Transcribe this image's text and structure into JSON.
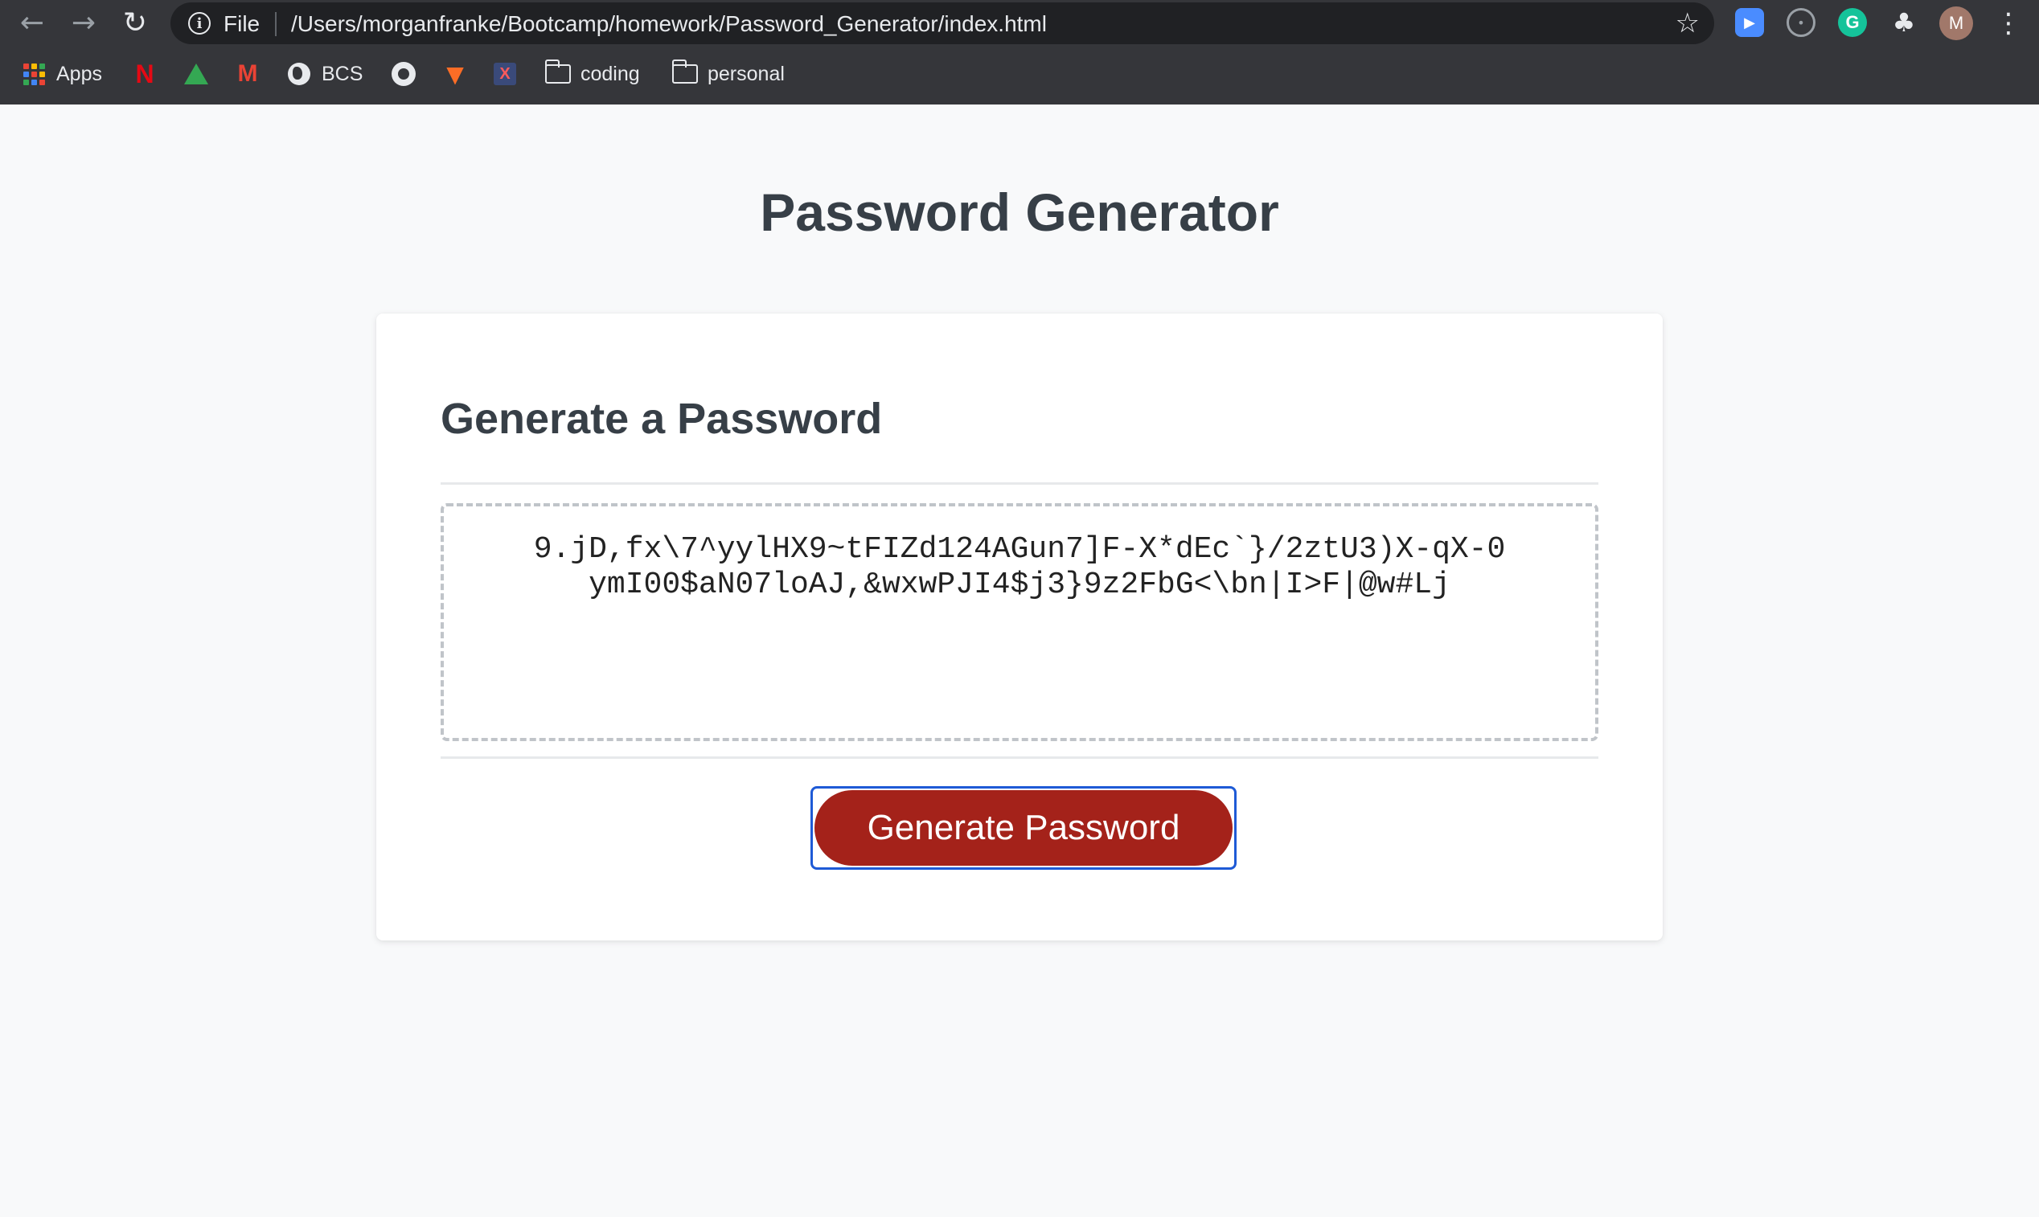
{
  "browser": {
    "nav": {
      "back_icon": "arrow-left-icon",
      "forward_icon": "arrow-right-icon",
      "reload_icon": "reload-icon"
    },
    "address_bar": {
      "scheme_label": "File",
      "url": "/Users/morganfranke/Bootcamp/homework/Password_Generator/index.html"
    },
    "extensions": [
      "zoom-extension-icon",
      "ghost-extension-icon",
      "grammarly-extension-icon",
      "puzzle-extensions-icon"
    ],
    "profile_initial": "M",
    "bookmarks": [
      {
        "label": "Apps",
        "icon": "apps-grid-icon"
      },
      {
        "label": "",
        "icon": "netflix-icon"
      },
      {
        "label": "",
        "icon": "google-drive-icon"
      },
      {
        "label": "",
        "icon": "gmail-icon"
      },
      {
        "label": "BCS",
        "icon": "globe-icon"
      },
      {
        "label": "",
        "icon": "github-icon"
      },
      {
        "label": "",
        "icon": "gitlab-icon"
      },
      {
        "label": "",
        "icon": "app-icon"
      },
      {
        "label": "coding",
        "icon": "folder-icon"
      },
      {
        "label": "personal",
        "icon": "folder-icon"
      }
    ],
    "colors": {
      "chrome_bg": "#35363a",
      "omnibox_bg": "#202124"
    }
  },
  "page": {
    "title": "Password Generator",
    "card": {
      "header": "Generate a Password",
      "password": "9.jD,fx\\7^yylHX9~tFIZd124AGun7]F-X*dEc`}/2ztU3)X-qX-0ymI00$aN07loAJ,&wxwPJI4$j3}9z2FbG<\\bn|I>F|@w#Lj",
      "button_label": "Generate Password"
    },
    "colors": {
      "button_bg": "#a4221a",
      "button_focus_ring": "#1e5ad6",
      "heading": "#373f47",
      "page_bg": "#f8f9fa"
    }
  }
}
